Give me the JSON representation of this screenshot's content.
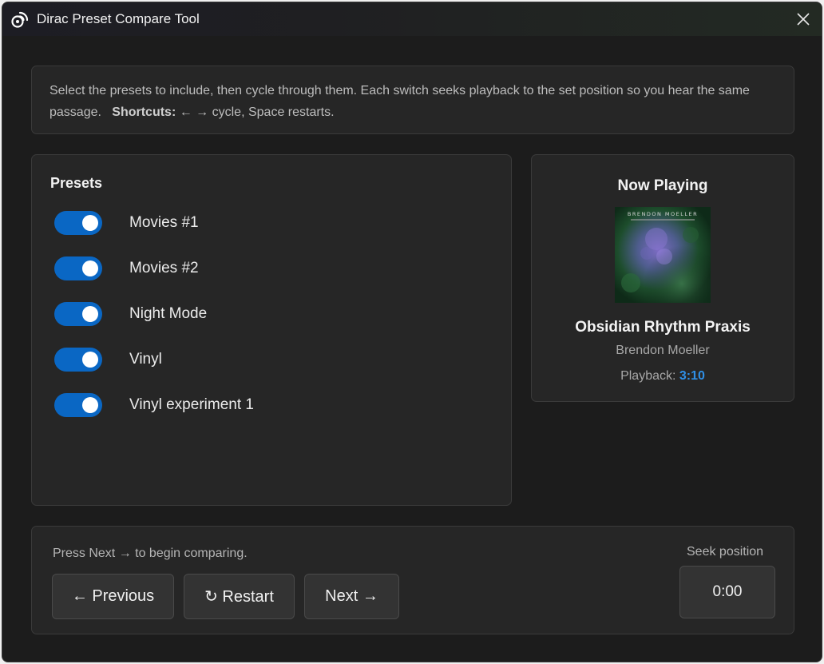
{
  "window": {
    "title": "Dirac Preset Compare Tool"
  },
  "info": {
    "text": "Select the presets to include, then cycle through them. Each switch seeks playback to the set position so you hear the same passage.",
    "shortcuts_label": "Shortcuts:",
    "shortcuts_text": "← → cycle,  Space restarts."
  },
  "presets": {
    "title": "Presets",
    "items": [
      {
        "label": "Movies #1",
        "enabled": true
      },
      {
        "label": "Movies #2",
        "enabled": true
      },
      {
        "label": "Night Mode",
        "enabled": true
      },
      {
        "label": "Vinyl",
        "enabled": true
      },
      {
        "label": "Vinyl experiment 1",
        "enabled": true
      }
    ]
  },
  "now_playing": {
    "title": "Now Playing",
    "album_art_text": "BRENDON MOELLER",
    "track": "Obsidian Rhythm Praxis",
    "artist": "Brendon Moeller",
    "playback_label": "Playback:",
    "playback_time": "3:10"
  },
  "controls": {
    "hint": "Press Next → to begin comparing.",
    "previous_label": "← Previous",
    "restart_label": "↻ Restart",
    "next_label": "Next →",
    "seek_label": "Seek position",
    "seek_value": "0:00"
  },
  "colors": {
    "accent": "#0a67c4",
    "playback_time": "#2f8fe6",
    "background": "#1c1c1c",
    "panel": "#262626"
  }
}
